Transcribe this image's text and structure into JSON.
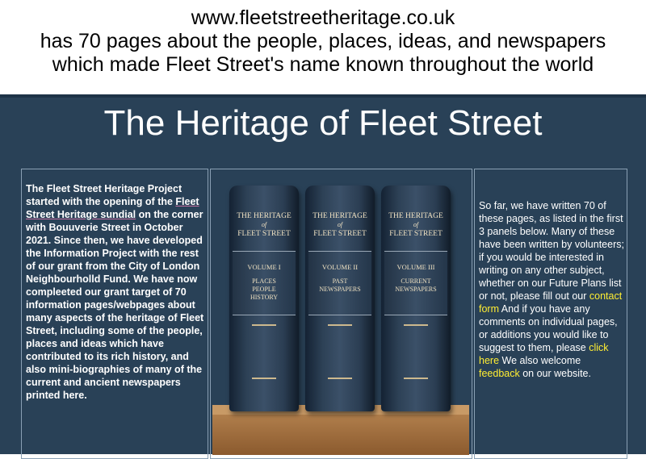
{
  "banner": {
    "line1": "www.fleetstreetheritage.co.uk",
    "line2": "has  70 pages  about the people, places, ideas, and newspapers",
    "line3": "which made Fleet Street's  name known throughout the world"
  },
  "page_title": "The Heritage of Fleet Street",
  "left_panel": {
    "text_before": "The Fleet Street Heritage Project started with the opening of the ",
    "sundial_link": "Fleet Street Heritage sundial",
    "text_after": " on the corner with Bouuverie Street in October 2021. Since then, we have developed the Information Project with the rest of our grant from the City of London Neighbourholld Fund. We have now compleeted our grant target of 70 information pages/webpages about many aspects of the heritage of Fleet Street, including some of the people, places and ideas which have contributed to its rich history, and also mini-biographies of many of the current and ancient newspapers printed here."
  },
  "books": [
    {
      "title_line1": "THE HERITAGE",
      "title_of": "of",
      "title_line2": "FLEET STREET",
      "volume": "VOLUME I",
      "subtitle": [
        "PLACES",
        "PEOPLE",
        "HISTORY"
      ]
    },
    {
      "title_line1": "THE HERITAGE",
      "title_of": "of",
      "title_line2": "FLEET STREET",
      "volume": "VOLUME II",
      "subtitle": [
        "PAST",
        "NEWSPAPERS"
      ]
    },
    {
      "title_line1": "THE HERITAGE",
      "title_of": "of",
      "title_line2": "FLEET STREET",
      "volume": "VOLUME III",
      "subtitle": [
        "CURRENT",
        "NEWSPAPERS"
      ]
    }
  ],
  "right_panel": {
    "text1": "So far, we have written 70 of these pages, as listed in the first 3 panels below. Many of these have been written by volunteers; if you would be interested in writing on any other subject, whether on our Future Plans list or not, please fill out our ",
    "contact_link": "contact form",
    "text2": " And if you have any comments on individual pages, or additions you would like to suggest to them, please ",
    "click_link": "click here",
    "text3": " We also welcome ",
    "feedback_link": "feedback",
    "text4": " on our website."
  },
  "colors": {
    "background": "#294157",
    "link_highlight": "#ffee33",
    "text": "#ffffff"
  }
}
